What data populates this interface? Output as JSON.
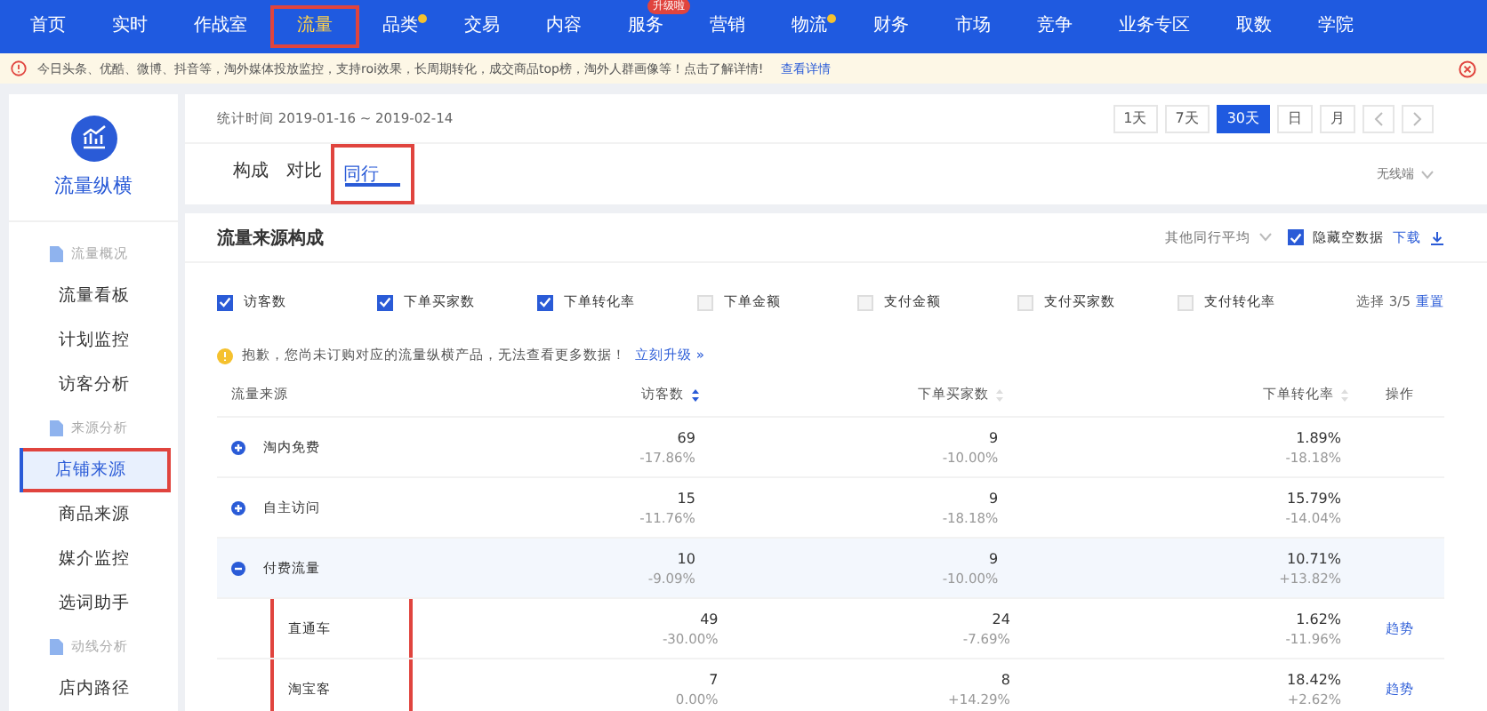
{
  "nav": [
    {
      "label": "首页",
      "selected": false,
      "highlight": false
    },
    {
      "label": "实时",
      "selected": false,
      "highlight": false
    },
    {
      "label": "作战室",
      "selected": false,
      "highlight": false
    },
    {
      "label": "流量",
      "selected": true,
      "highlight": true
    },
    {
      "label": "品类",
      "selected": false,
      "highlight": false,
      "dot": true
    },
    {
      "label": "交易",
      "selected": false,
      "highlight": false
    },
    {
      "label": "内容",
      "selected": false,
      "highlight": false
    },
    {
      "label": "服务",
      "selected": false,
      "highlight": false,
      "badge": "升级啦"
    },
    {
      "label": "营销",
      "selected": false,
      "highlight": false
    },
    {
      "label": "物流",
      "selected": false,
      "highlight": false,
      "dot": true
    },
    {
      "label": "财务",
      "selected": false,
      "highlight": false
    },
    {
      "label": "市场",
      "selected": false,
      "highlight": false
    },
    {
      "label": "竞争",
      "selected": false,
      "highlight": false
    },
    {
      "label": "业务专区",
      "selected": false,
      "highlight": false
    },
    {
      "label": "取数",
      "selected": false,
      "highlight": false
    },
    {
      "label": "学院",
      "selected": false,
      "highlight": false
    }
  ],
  "notice": {
    "text": "今日头条、优酷、微博、抖音等，淘外媒体投放监控，支持roi效果，长周期转化，成交商品top榜，淘外人群画像等！点击了解详情!",
    "link": "查看详情"
  },
  "sidebar": {
    "title": "流量纵横",
    "groups": [
      {
        "label": "流量概况",
        "items": [
          {
            "label": "流量看板",
            "selected": false,
            "highlight": false
          },
          {
            "label": "计划监控",
            "selected": false,
            "highlight": false
          },
          {
            "label": "访客分析",
            "selected": false,
            "highlight": false
          }
        ]
      },
      {
        "label": "来源分析",
        "items": [
          {
            "label": "店铺来源",
            "selected": true,
            "highlight": true
          },
          {
            "label": "商品来源",
            "selected": false,
            "highlight": false
          },
          {
            "label": "媒介监控",
            "selected": false,
            "highlight": false
          },
          {
            "label": "选词助手",
            "selected": false,
            "highlight": false
          }
        ]
      },
      {
        "label": "动线分析",
        "items": [
          {
            "label": "店内路径",
            "selected": false,
            "highlight": false
          }
        ]
      }
    ]
  },
  "period": {
    "text": "统计时间 2019-01-16 ~ 2019-02-14",
    "ranges": [
      {
        "label": "1天",
        "selected": false
      },
      {
        "label": "7天",
        "selected": false
      },
      {
        "label": "30天",
        "selected": true
      },
      {
        "label": "日",
        "selected": false
      },
      {
        "label": "月",
        "selected": false
      }
    ]
  },
  "tabs": [
    {
      "label": "构成",
      "selected": false,
      "highlight": false
    },
    {
      "label": "对比",
      "selected": false,
      "highlight": false
    },
    {
      "label": "同行",
      "selected": true,
      "highlight": true
    }
  ],
  "terminal": "无线端",
  "panel": {
    "title": "流量来源构成",
    "compare": "其他同行平均",
    "hide_empty": {
      "label": "隐藏空数据",
      "checked": true
    },
    "download": "下载",
    "metrics": [
      {
        "label": "访客数",
        "checked": true
      },
      {
        "label": "下单买家数",
        "checked": true
      },
      {
        "label": "下单转化率",
        "checked": true
      },
      {
        "label": "下单金额",
        "checked": false
      },
      {
        "label": "支付金额",
        "checked": false
      },
      {
        "label": "支付买家数",
        "checked": false
      },
      {
        "label": "支付转化率",
        "checked": false
      }
    ],
    "selection": "选择 3/5",
    "reset": "重置",
    "warning": "抱歉，您尚未订购对应的流量纵横产品，无法查看更多数据！",
    "upgrade": "立刻升级 »",
    "columns": [
      "流量来源",
      "访客数",
      "下单买家数",
      "下单转化率",
      "操作"
    ],
    "rows": [
      {
        "source": "淘内免费",
        "expanded": false,
        "highlight": false,
        "visitors": {
          "value": "69",
          "change": "-17.86%"
        },
        "buyers": {
          "value": "9",
          "change": "-10.00%"
        },
        "rate": {
          "value": "1.89%",
          "change": "-18.18%"
        }
      },
      {
        "source": "自主访问",
        "expanded": false,
        "highlight": false,
        "visitors": {
          "value": "15",
          "change": "-11.76%"
        },
        "buyers": {
          "value": "9",
          "change": "-18.18%"
        },
        "rate": {
          "value": "15.79%",
          "change": "-14.04%"
        }
      },
      {
        "source": "付费流量",
        "expanded": true,
        "highlight": false,
        "visitors": {
          "value": "10",
          "change": "-9.09%"
        },
        "buyers": {
          "value": "9",
          "change": "-10.00%"
        },
        "rate": {
          "value": "10.71%",
          "change": "+13.82%"
        },
        "children": [
          {
            "source": "直通车",
            "highlight": true,
            "visitors": {
              "value": "49",
              "change": "-30.00%"
            },
            "buyers": {
              "value": "24",
              "change": "-7.69%"
            },
            "rate": {
              "value": "1.62%",
              "change": "-11.96%"
            },
            "action": "趋势"
          },
          {
            "source": "淘宝客",
            "highlight": true,
            "visitors": {
              "value": "7",
              "change": "0.00%"
            },
            "buyers": {
              "value": "8",
              "change": "+14.29%"
            },
            "rate": {
              "value": "18.42%",
              "change": "+2.62%"
            },
            "action": "趋势"
          }
        ]
      }
    ]
  }
}
